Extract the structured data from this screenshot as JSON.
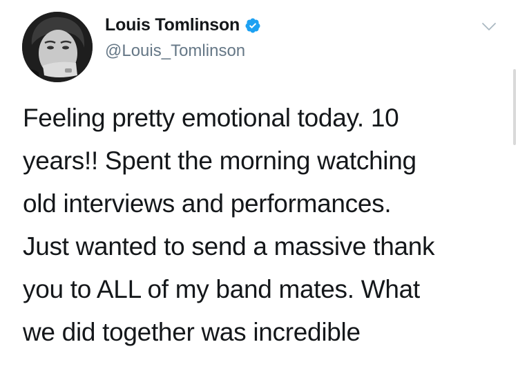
{
  "tweet": {
    "author": {
      "display_name": "Louis Tomlinson",
      "handle": "@Louis_Tomlinson",
      "verified": true
    },
    "text": "Feeling pretty emotional today. 10\nyears!! Spent the morning watching\nold interviews and performances.\nJust wanted to send a massive thank\nyou to ALL of my band mates. What\nwe did together was incredible"
  },
  "icons": {
    "verified": "verified-badge-icon",
    "more": "chevron-down-icon"
  },
  "colors": {
    "verified": "#1da1f2",
    "handle": "#657786",
    "text": "#14171a"
  }
}
